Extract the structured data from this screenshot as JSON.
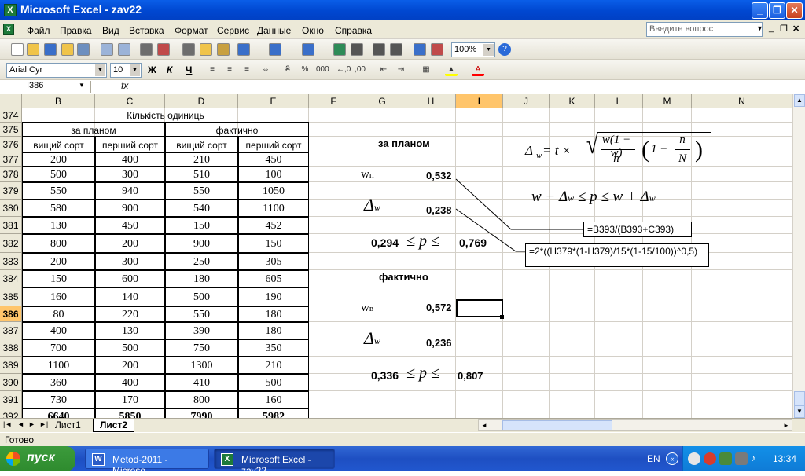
{
  "window": {
    "title": "Microsoft Excel - zav22"
  },
  "menu": [
    "Файл",
    "Правка",
    "Вид",
    "Вставка",
    "Формат",
    "Сервис",
    "Данные",
    "Окно",
    "Справка"
  ],
  "help_placeholder": "Введите вопрос",
  "toolbar": {
    "zoom": "100%",
    "font_name": "Arial Cyr",
    "font_size": "10",
    "bold": "Ж",
    "italic": "К",
    "underline": "Ч"
  },
  "formula_bar": {
    "name_box": "I386",
    "fx": "fx"
  },
  "columns": [
    "B",
    "C",
    "D",
    "E",
    "F",
    "G",
    "H",
    "I",
    "J",
    "K",
    "L",
    "M",
    "N"
  ],
  "rows": [
    "374",
    "375",
    "376",
    "377",
    "378",
    "379",
    "380",
    "381",
    "382",
    "383",
    "384",
    "385",
    "386",
    "387",
    "388",
    "389",
    "390",
    "391",
    "392"
  ],
  "selected_row": "386",
  "selected_column": "I",
  "table": {
    "title": "Кількість одиниць",
    "group1": "за планом",
    "group2": "фактично",
    "headers": [
      "вищий сорт",
      "перший сорт",
      "вищий сорт",
      "перший сорт"
    ],
    "data": [
      [
        "200",
        "400",
        "210",
        "450"
      ],
      [
        "500",
        "300",
        "510",
        "100"
      ],
      [
        "550",
        "940",
        "550",
        "1050"
      ],
      [
        "580",
        "900",
        "540",
        "1100"
      ],
      [
        "130",
        "450",
        "150",
        "452"
      ],
      [
        "800",
        "200",
        "900",
        "150"
      ],
      [
        "200",
        "300",
        "250",
        "305"
      ],
      [
        "150",
        "600",
        "180",
        "605"
      ],
      [
        "160",
        "140",
        "500",
        "190"
      ],
      [
        "80",
        "220",
        "550",
        "180"
      ],
      [
        "400",
        "130",
        "390",
        "180"
      ],
      [
        "700",
        "500",
        "750",
        "350"
      ],
      [
        "1100",
        "200",
        "1300",
        "210"
      ],
      [
        "360",
        "400",
        "410",
        "500"
      ],
      [
        "730",
        "170",
        "800",
        "160"
      ]
    ],
    "totals": [
      "6640",
      "5850",
      "7990",
      "5982"
    ]
  },
  "calc": {
    "plan_label": "за планом",
    "fact_label": "фактично",
    "w_plan_label": "w",
    "w_plan_sub": "п",
    "w_plan": "0,532",
    "delta_plan": "0,238",
    "lower_plan": "0,294",
    "upper_plan": "0,769",
    "w_fact_label": "w",
    "w_fact_sub": "в",
    "w_fact": "0,572",
    "delta_fact": "0,236",
    "lower_fact": "0,336",
    "upper_fact": "0,807",
    "leq_p_leq": "≤ p ≤",
    "delta_symbol": "Δ",
    "delta_sub": "w"
  },
  "formulas": {
    "f1": "=B393/(B393+C393)",
    "f2": "=2*((H379*(1-H379)/15*(1-15/100))^0,5)"
  },
  "equations": {
    "eq1_lhs": "Δ",
    "eq1_sub": "w",
    "eq1_rest": " = t ×",
    "eq1_num": "w(1 − w)",
    "eq1_den": "n",
    "eq1_paren_one": "1 −",
    "eq1_frac_num": "n",
    "eq1_frac_den": "N",
    "eq2": "w − Δ",
    "eq2_sub": "w",
    "eq2_mid": " ≤ p ≤ w + Δ",
    "eq2_sub2": "w"
  },
  "sheets": [
    "Лист1",
    "Лист2"
  ],
  "active_sheet": "Лист2",
  "status": "Готово",
  "taskbar": {
    "start": "пуск",
    "tasks": [
      "Metod-2011 - Microso...",
      "Microsoft Excel - zav22"
    ],
    "lang": "EN",
    "clock": "13:34"
  }
}
